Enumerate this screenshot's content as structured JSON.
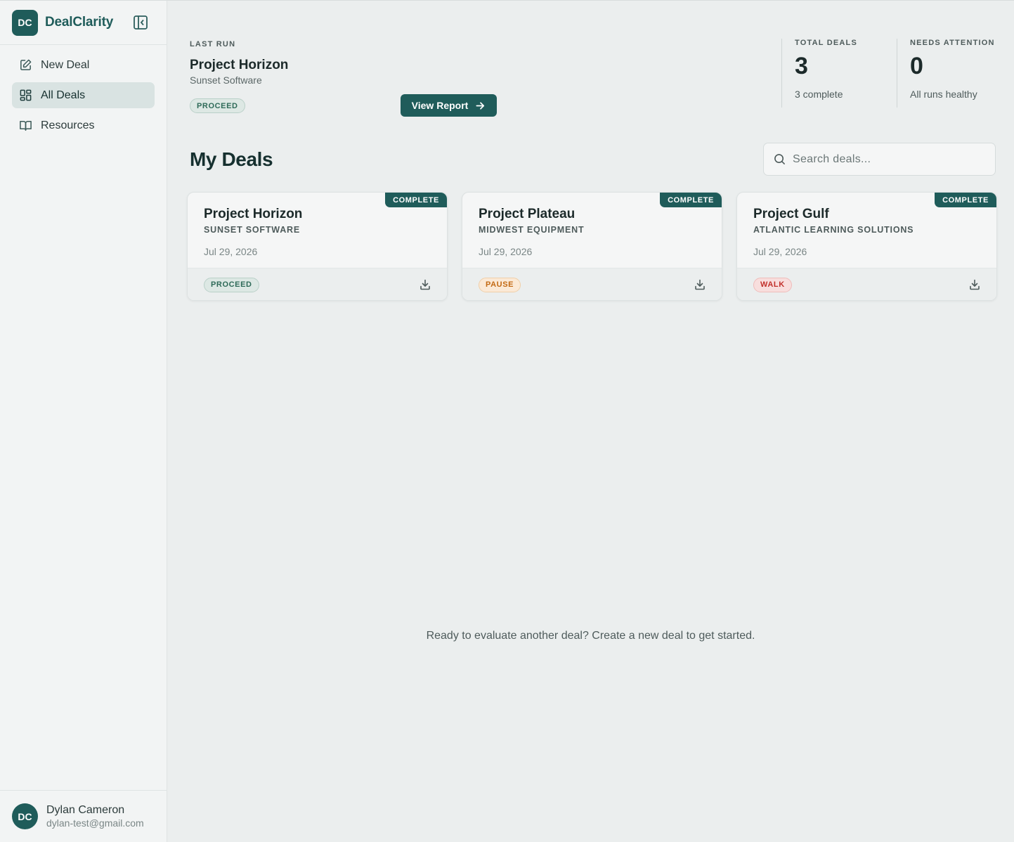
{
  "brand": {
    "initials": "DC",
    "name": "DealClarity"
  },
  "nav": [
    {
      "label": "New Deal",
      "icon": "edit-icon"
    },
    {
      "label": "All Deals",
      "icon": "grid-icon",
      "active": true
    },
    {
      "label": "Resources",
      "icon": "book-icon"
    }
  ],
  "user": {
    "initials": "DC",
    "name": "Dylan Cameron",
    "email": "dylan-test@gmail.com"
  },
  "last_run": {
    "eyebrow": "LAST RUN",
    "title": "Project Horizon",
    "company": "Sunset Software",
    "verdict": "PROCEED",
    "button": "View Report"
  },
  "stats": {
    "total": {
      "label": "TOTAL DEALS",
      "value": "3",
      "note": "3 complete"
    },
    "attention": {
      "label": "NEEDS ATTENTION",
      "value": "0",
      "note": "All runs healthy"
    }
  },
  "section_title": "My Deals",
  "search": {
    "placeholder": "Search deals..."
  },
  "deals": [
    {
      "status": "COMPLETE",
      "title": "Project Horizon",
      "company": "SUNSET SOFTWARE",
      "date": "Jul 29, 2026",
      "verdict": "PROCEED"
    },
    {
      "status": "COMPLETE",
      "title": "Project Plateau",
      "company": "MIDWEST EQUIPMENT",
      "date": "Jul 29, 2026",
      "verdict": "PAUSE"
    },
    {
      "status": "COMPLETE",
      "title": "Project Gulf",
      "company": "ATLANTIC LEARNING SOLUTIONS",
      "date": "Jul 29, 2026",
      "verdict": "WALK"
    }
  ],
  "empty_message": "Ready to evaluate another deal? Create a new deal to get started.",
  "colors": {
    "brand": "#1f5c5a",
    "proceed": "#2e6a58",
    "pause": "#c36a14",
    "walk": "#c2302b"
  }
}
